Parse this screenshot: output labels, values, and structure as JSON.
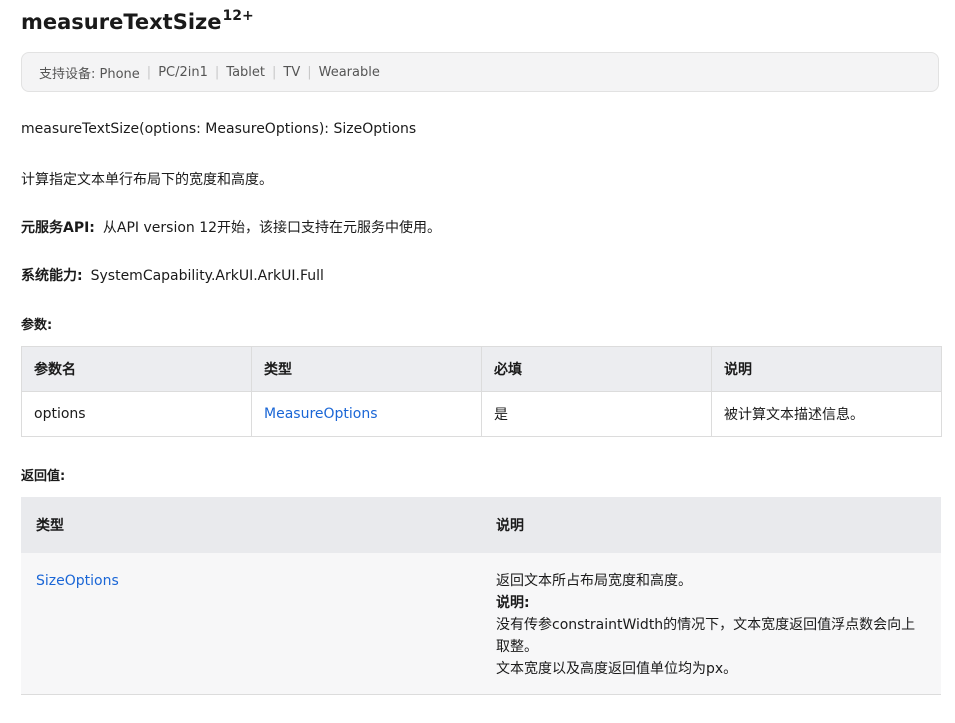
{
  "title": {
    "name": "measureTextSize",
    "sup": "12+"
  },
  "devices": {
    "label": "支持设备: Phone",
    "items": [
      "PC/2in1",
      "Tablet",
      "TV",
      "Wearable"
    ]
  },
  "signature": "measureTextSize(options: MeasureOptions): SizeOptions",
  "description": "计算指定文本单行布局下的宽度和高度。",
  "atomic": {
    "label": "元服务API:",
    "text": "从API version 12开始，该接口支持在元服务中使用。"
  },
  "syscap": {
    "label": "系统能力:",
    "text": "SystemCapability.ArkUI.ArkUI.Full"
  },
  "params": {
    "label": "参数:",
    "headers": [
      "参数名",
      "类型",
      "必填",
      "说明"
    ],
    "rows": [
      {
        "name": "options",
        "type": "MeasureOptions",
        "required": "是",
        "desc": "被计算文本描述信息。"
      }
    ]
  },
  "returns": {
    "label": "返回值:",
    "headers": [
      "类型",
      "说明"
    ],
    "row": {
      "type": "SizeOptions",
      "desc": "返回文本所占布局宽度和高度。",
      "note_label": "说明:",
      "note_1": "没有传参constraintWidth的情况下，文本宽度返回值浮点数会向上取整。",
      "note_2": "文本宽度以及高度返回值单位均为px。"
    }
  },
  "colors": {
    "link": "#1a66d6",
    "header_bg": "#ecedf0"
  }
}
